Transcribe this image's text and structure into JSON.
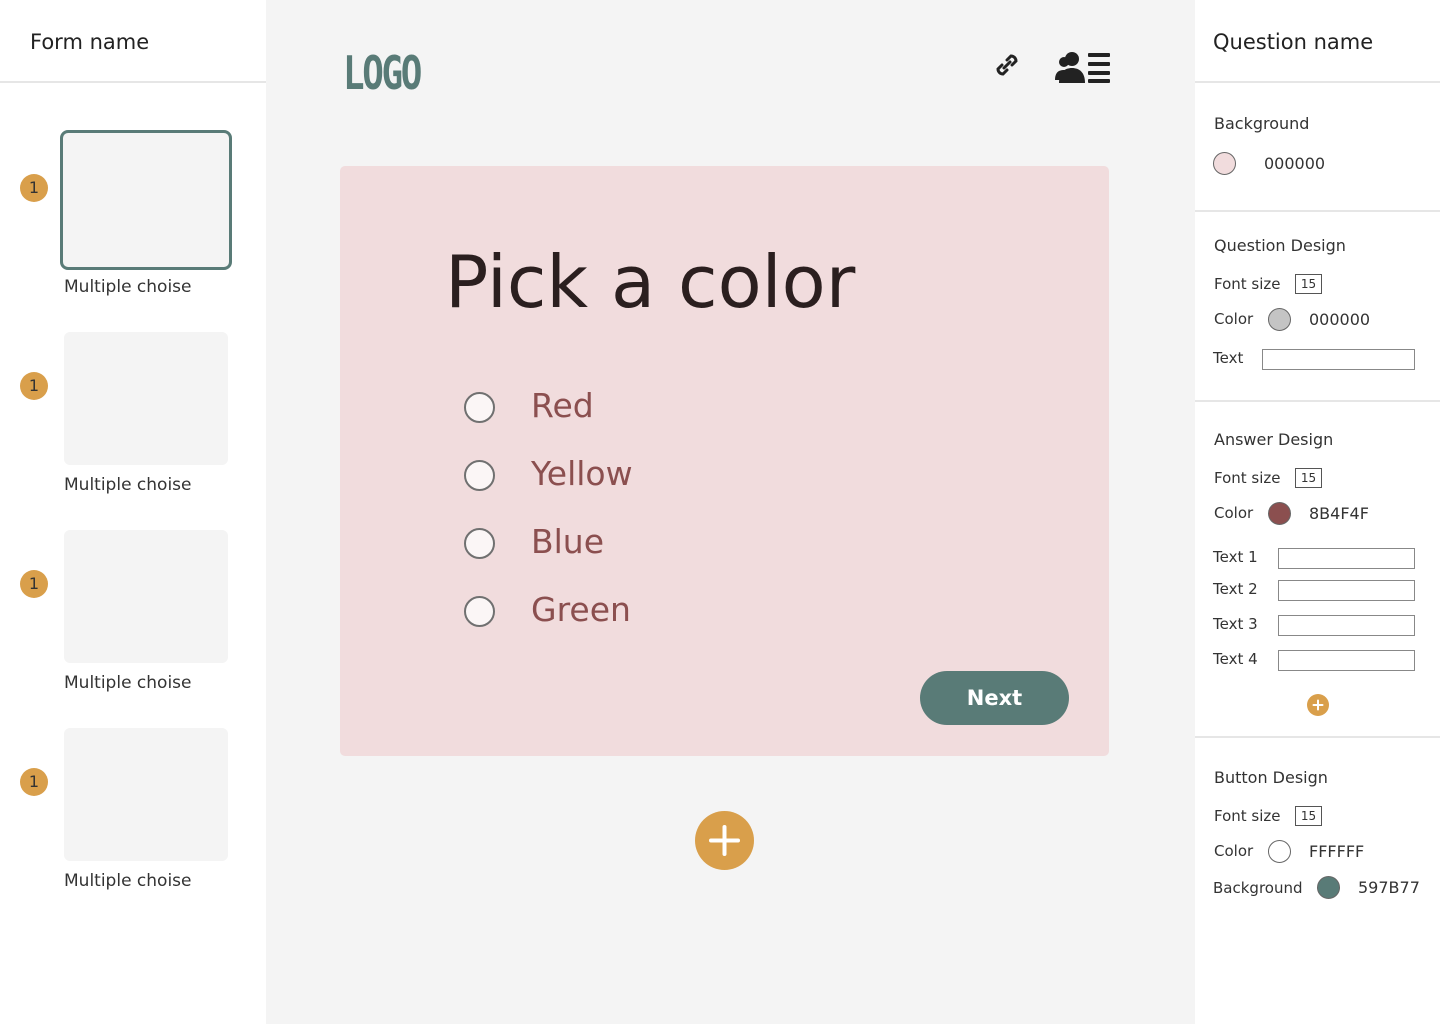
{
  "left_panel": {
    "title": "Form name",
    "slides": [
      {
        "badge": "1",
        "label": "Multiple choise",
        "active": true
      },
      {
        "badge": "1",
        "label": "Multiple choise",
        "active": false
      },
      {
        "badge": "1",
        "label": "Multiple choise",
        "active": false
      },
      {
        "badge": "1",
        "label": "Multiple choise",
        "active": false
      }
    ]
  },
  "header": {
    "logo": "LOGO",
    "icons": [
      "link-icon",
      "users-list-icon"
    ]
  },
  "question_card": {
    "background": "#f1dcdd",
    "title": "Pick a color",
    "options": [
      "Red",
      "Yellow",
      "Blue",
      "Green"
    ],
    "next_label": "Next",
    "add_icon": "plus-icon"
  },
  "right_panel": {
    "title": "Question name",
    "background": {
      "section_title": "Background",
      "swatch_color": "#f1dcdd",
      "hex": "000000"
    },
    "question_design": {
      "section_title": "Question Design",
      "font_size_label": "Font size",
      "font_size": "15",
      "color_label": "Color",
      "swatch_color": "#c4c4c4",
      "hex": "000000",
      "text_label": "Text",
      "text_value": ""
    },
    "answer_design": {
      "section_title": "Answer Design",
      "font_size_label": "Font size",
      "font_size": "15",
      "color_label": "Color",
      "swatch_color": "#8b4f4f",
      "hex": "8B4F4F",
      "text_labels": [
        "Text 1",
        "Text 2",
        "Text 3",
        "Text 4"
      ],
      "text_values": [
        "",
        "",
        "",
        ""
      ],
      "add_icon": "plus-icon"
    },
    "button_design": {
      "section_title": "Button Design",
      "font_size_label": "Font size",
      "font_size": "15",
      "color_label": "Color",
      "color_swatch": "#ffffff",
      "color_hex": "FFFFFF",
      "background_label": "Background",
      "background_swatch": "#597b77",
      "background_hex": "597B77"
    }
  },
  "colors": {
    "accent": "#597b77",
    "badge": "#d99f4b",
    "answer_text": "#8b4f4f"
  }
}
